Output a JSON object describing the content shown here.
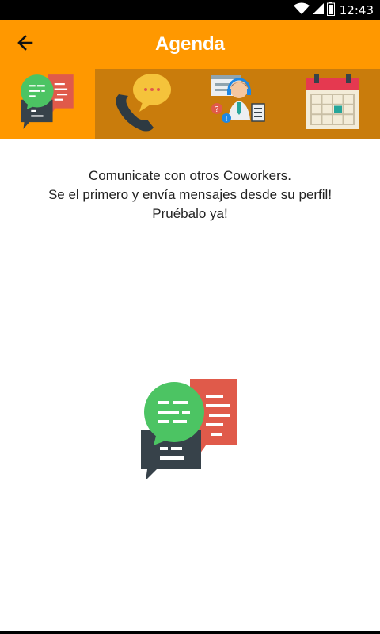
{
  "status_bar": {
    "time": "12:43",
    "icons": [
      "wifi-icon",
      "signal-icon",
      "battery-icon"
    ]
  },
  "app_bar": {
    "title": "Agenda",
    "back_icon": "arrow-left-icon"
  },
  "tabs": [
    {
      "id": "chat",
      "icon": "chat-bubbles-icon",
      "active": true
    },
    {
      "id": "phone",
      "icon": "phone-call-icon",
      "active": false
    },
    {
      "id": "support",
      "icon": "support-agent-icon",
      "active": false
    },
    {
      "id": "calendar",
      "icon": "calendar-icon",
      "active": false
    }
  ],
  "content": {
    "line1": "Comunicate con otros Coworkers.",
    "line2": "Se el primero y envía mensajes desde su perfil!",
    "line3": "Pruébalo ya!",
    "illustration_icon": "chat-bubbles-icon"
  },
  "colors": {
    "primary": "#FF9800",
    "tab_bar": "#C97C0C",
    "green_bubble": "#4CC463",
    "red_bubble": "#E05A4A",
    "dark_bubble": "#37424A"
  }
}
